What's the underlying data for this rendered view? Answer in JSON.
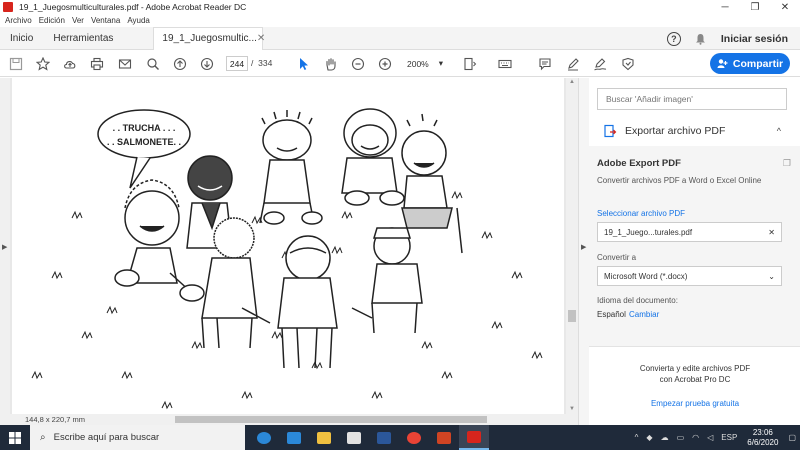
{
  "window": {
    "title": "19_1_Juegosmulticulturales.pdf - Adobe Acrobat Reader DC",
    "controls": [
      "─",
      "❐",
      "✕"
    ]
  },
  "menu": [
    "Archivo",
    "Edición",
    "Ver",
    "Ventana",
    "Ayuda"
  ],
  "tabs": {
    "home": "Inicio",
    "tools": "Herramientas",
    "document": "19_1_Juegosmultic...",
    "close": "✕",
    "signin": "Iniciar sesión",
    "help": "?"
  },
  "toolbar": {
    "page_current": "244",
    "page_sep": "/",
    "page_total": "334",
    "zoom": "200%",
    "zoom_caret": "▾",
    "share_label": "Compartir"
  },
  "document": {
    "speech_line1": ". . TRUCHA . . .",
    "speech_line2": ". . SALMONETE. .",
    "page_dims": "144,8 x 220,7 mm"
  },
  "right_panel": {
    "search_placeholder": "Buscar 'Añadir imagen'",
    "export_label": "Exportar archivo PDF",
    "export_chevron": "^",
    "ae_title": "Adobe Export PDF",
    "ae_desc": "Convertir archivos PDF a Word o Excel Online",
    "select_label": "Seleccionar archivo PDF",
    "file_name": "19_1_Juego...turales.pdf",
    "file_clear": "✕",
    "convert_label": "Convertir a",
    "convert_value": "Microsoft Word (*.docx)",
    "convert_caret": "⌄",
    "lang_label": "Idioma del documento:",
    "lang_value": "Español",
    "lang_change": "Cambiar",
    "promo_line1": "Convierta y edite archivos PDF",
    "promo_line2": "con Acrobat Pro DC",
    "promo_link": "Empezar prueba gratuita"
  },
  "taskbar": {
    "search_text": "Escribe aquí para buscar",
    "lang": "ESP",
    "time": "23:06",
    "date": "6/6/2020",
    "app_colors": [
      "#2b88d8",
      "#f0c040",
      "#e2e2e2",
      "#ffffff",
      "#2b579a",
      "#ea4335",
      "#d04423",
      "#d7251d"
    ]
  }
}
